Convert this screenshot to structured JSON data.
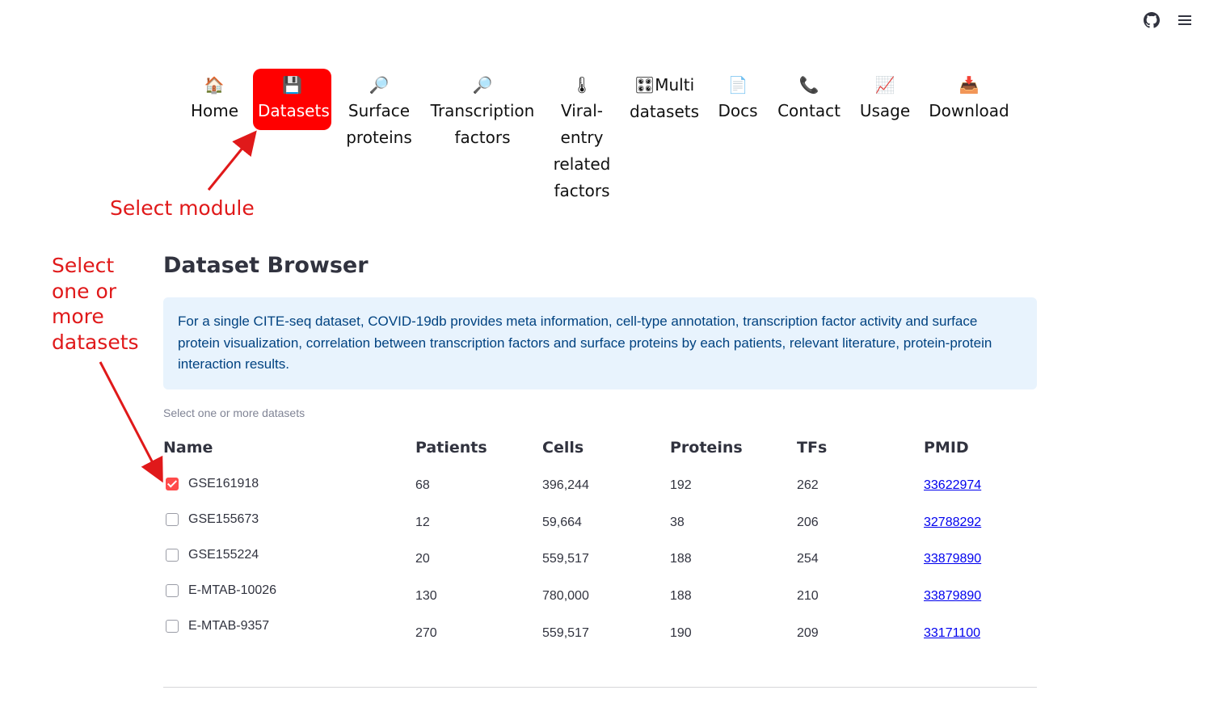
{
  "topbar": {
    "github_icon": "github-icon",
    "menu_icon": "hamburger-menu-icon"
  },
  "nav": {
    "items": [
      {
        "emoji": "🏠",
        "label": "Home",
        "active": false
      },
      {
        "emoji": "💾",
        "label": "Datasets",
        "active": true
      },
      {
        "emoji": "🔎",
        "label": "Surface\nproteins",
        "active": false
      },
      {
        "emoji": "🔎",
        "label": "Transcription\nfactors",
        "active": false
      },
      {
        "emoji": "🌡",
        "label": "Viral-\nentry\nrelated\nfactors",
        "active": false
      },
      {
        "emoji": "🎛",
        "label": "Multi\ndatasets",
        "active": false
      },
      {
        "emoji": "📄",
        "label": "Docs",
        "active": false
      },
      {
        "emoji": "📞",
        "label": "Contact",
        "active": false
      },
      {
        "emoji": "📈",
        "label": "Usage",
        "active": false
      },
      {
        "emoji": "📥",
        "label": "Download",
        "active": false
      }
    ]
  },
  "annotations": {
    "select_module": "Select module",
    "select_datasets": "Select\none or\nmore\ndatasets",
    "color": "#e0191a"
  },
  "main": {
    "title": "Dataset Browser",
    "info": "For a single CITE-seq dataset, COVID-19db provides meta information, cell-type annotation, transcription factor activity and surface protein visualization, correlation between transcription factors and surface proteins by each patients, relevant literature, protein-protein interaction results.",
    "select_label": "Select one or more datasets"
  },
  "table": {
    "headers": {
      "name": "Name",
      "patients": "Patients",
      "cells": "Cells",
      "proteins": "Proteins",
      "tfs": "TFs",
      "pmid": "PMID"
    },
    "rows": [
      {
        "name": "GSE161918",
        "checked": true,
        "patients": "68",
        "cells": "396,244",
        "proteins": "192",
        "tfs": "262",
        "pmid": "33622974"
      },
      {
        "name": "GSE155673",
        "checked": false,
        "patients": "12",
        "cells": "59,664",
        "proteins": "38",
        "tfs": "206",
        "pmid": "32788292"
      },
      {
        "name": "GSE155224",
        "checked": false,
        "patients": "20",
        "cells": "559,517",
        "proteins": "188",
        "tfs": "254",
        "pmid": "33879890"
      },
      {
        "name": "E-MTAB-10026",
        "checked": false,
        "patients": "130",
        "cells": "780,000",
        "proteins": "188",
        "tfs": "210",
        "pmid": "33879890"
      },
      {
        "name": "E-MTAB-9357",
        "checked": false,
        "patients": "270",
        "cells": "559,517",
        "proteins": "190",
        "tfs": "209",
        "pmid": "33171100"
      }
    ]
  },
  "colors": {
    "active_tab": "#ff0000",
    "checkbox_checked": "#ff4b4b",
    "info_bg": "#e8f3fd",
    "info_text": "#004280"
  }
}
